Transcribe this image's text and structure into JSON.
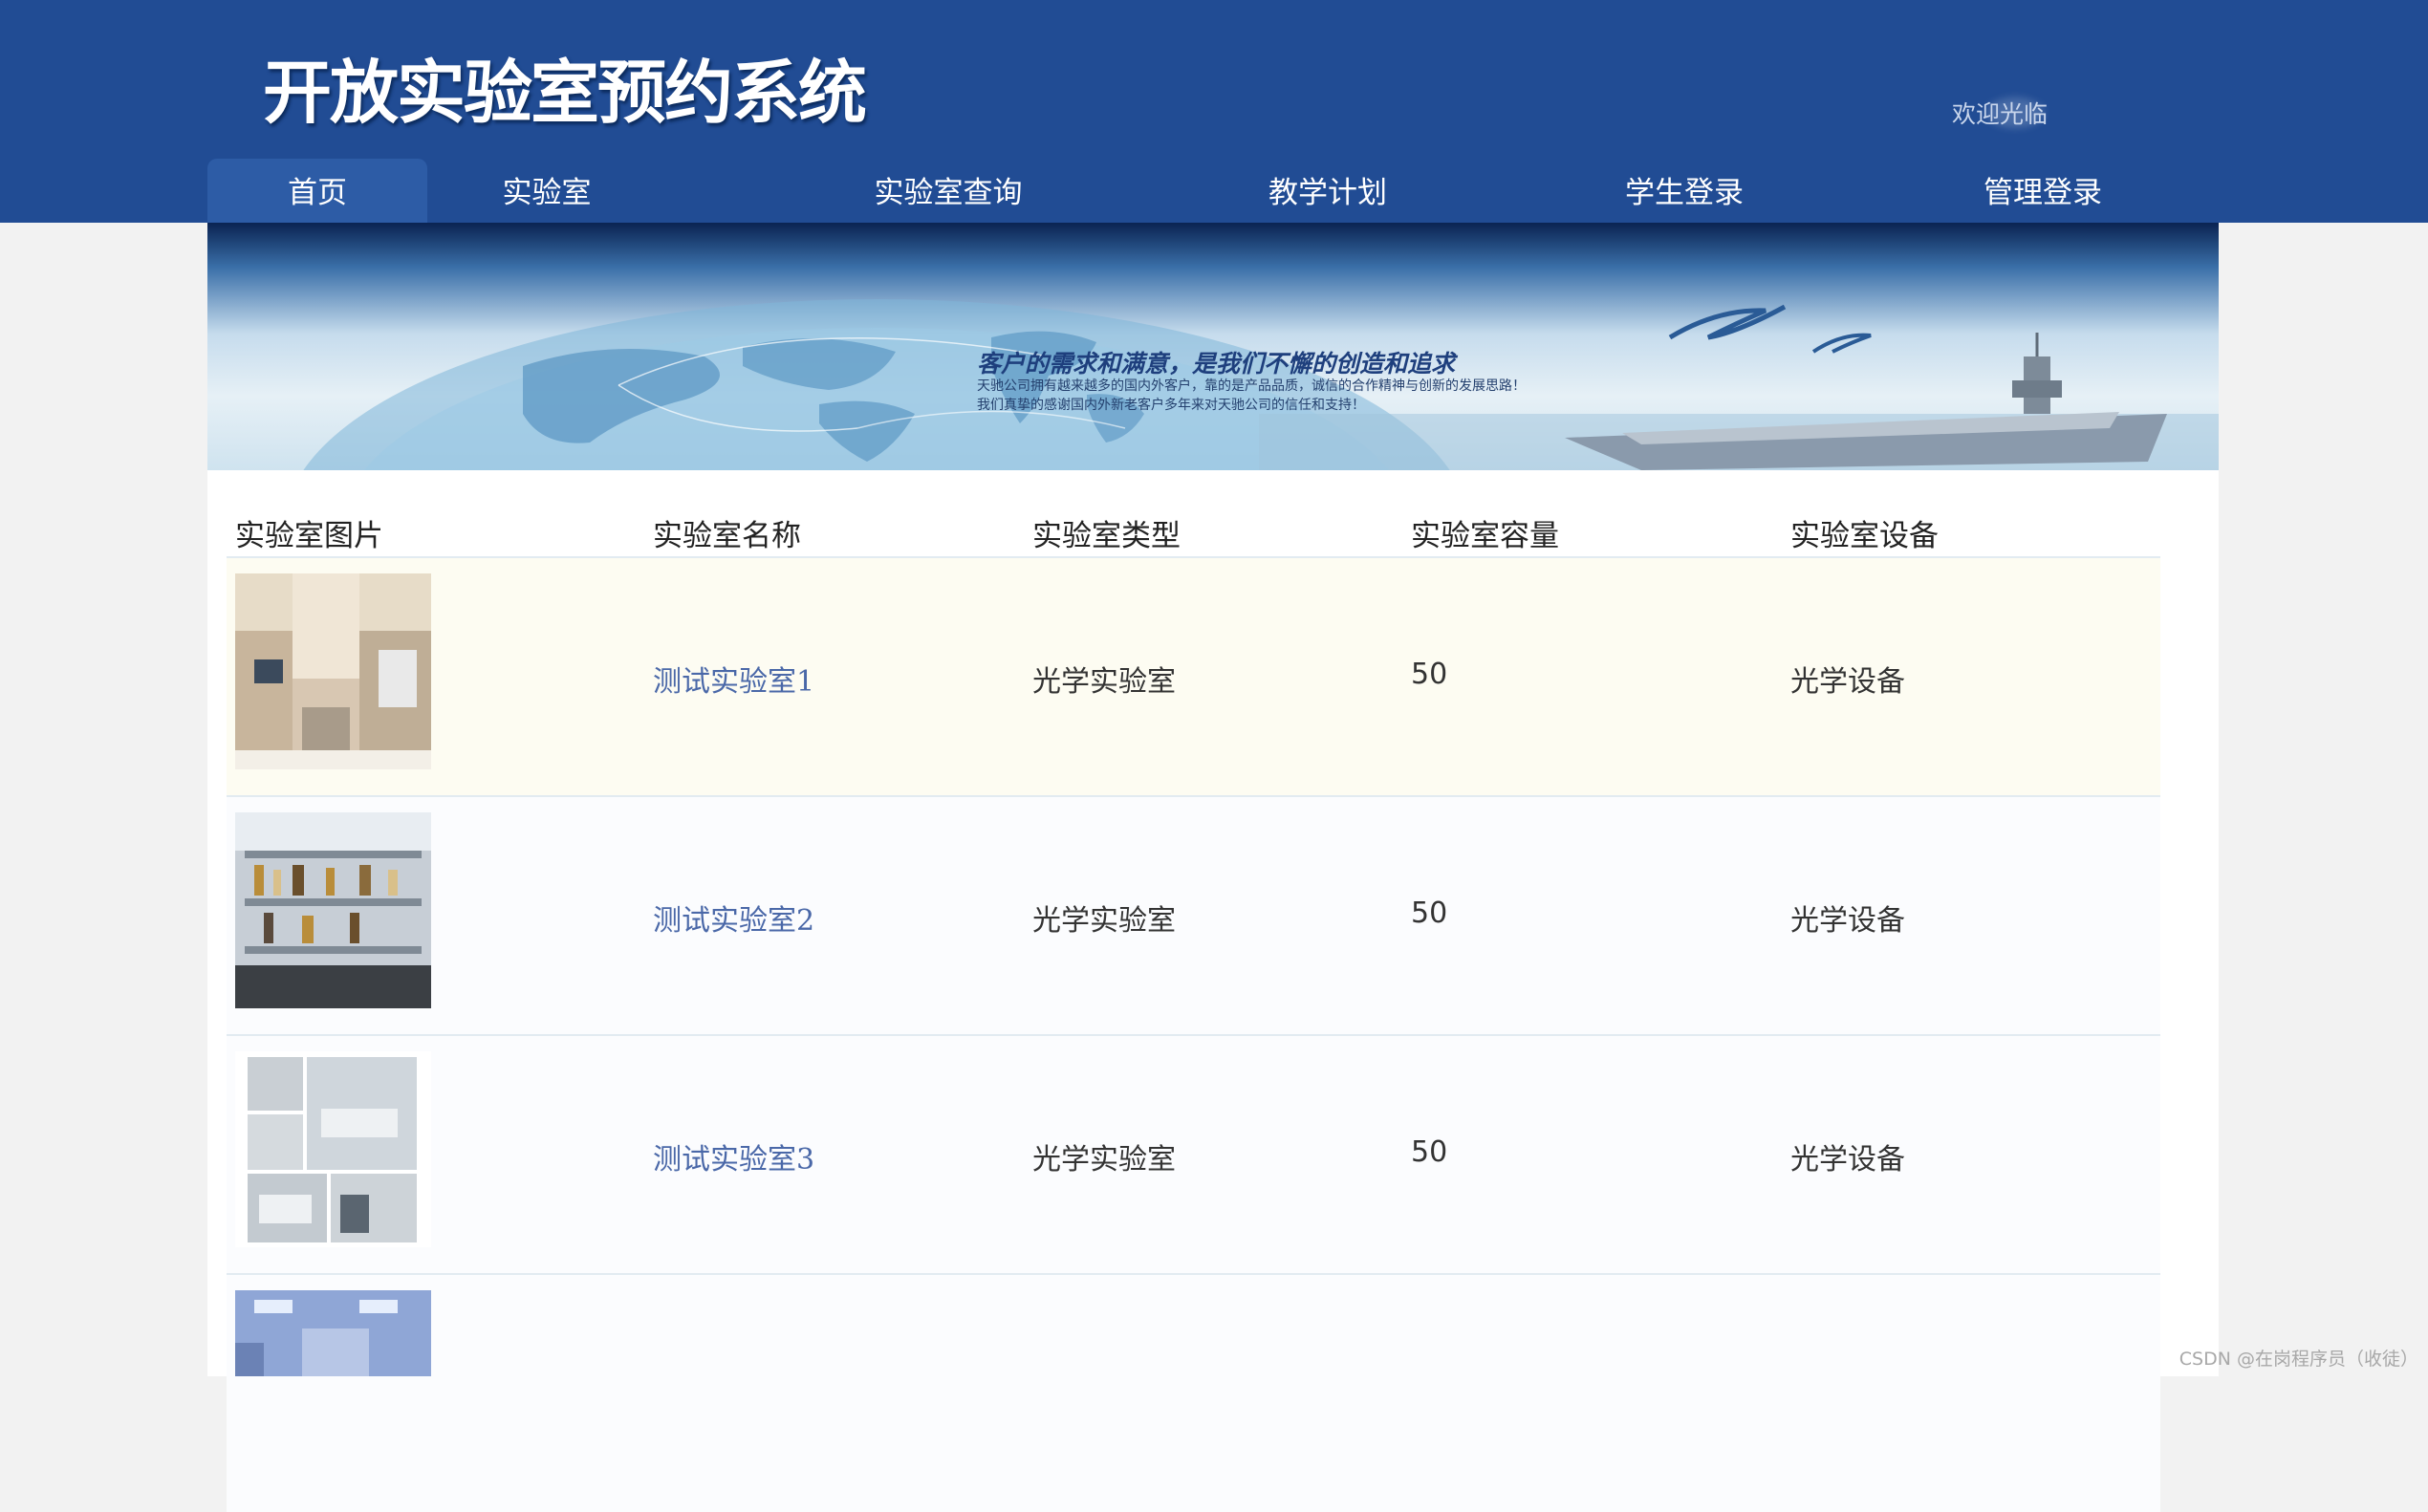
{
  "header": {
    "title": "开放实验室预约系统",
    "welcome": "欢迎光临",
    "background_color": "#214c94"
  },
  "nav": {
    "items": [
      {
        "label": "首页",
        "active": true
      },
      {
        "label": "实验室"
      },
      {
        "label": "实验室查询"
      },
      {
        "label": "教学计划"
      },
      {
        "label": "学生登录"
      },
      {
        "label": "管理登录"
      }
    ]
  },
  "banner": {
    "slogan": "客户的需求和满意，是我们不懈的创造和追求",
    "line1": "天驰公司拥有越来越多的国内外客户，靠的是产品品质，诚信的合作精神与创新的发展思路！",
    "line2": "我们真挚的感谢国内外新老客户多年来对天驰公司的信任和支持！"
  },
  "table": {
    "headers": [
      "实验室图片",
      "实验室名称",
      "实验室类型",
      "实验室容量",
      "实验室设备"
    ],
    "rows": [
      {
        "image": "lab-photo-1",
        "name": "测试实验室1",
        "type": "光学实验室",
        "capacity": "50",
        "equipment": "光学设备"
      },
      {
        "image": "lab-photo-2",
        "name": "测试实验室2",
        "type": "光学实验室",
        "capacity": "50",
        "equipment": "光学设备"
      },
      {
        "image": "lab-photo-3",
        "name": "测试实验室3",
        "type": "光学实验室",
        "capacity": "50",
        "equipment": "光学设备"
      },
      {
        "image": "lab-photo-4",
        "name": "",
        "type": "",
        "capacity": "",
        "equipment": ""
      }
    ]
  },
  "watermark": "CSDN @在岗程序员（收徒）"
}
